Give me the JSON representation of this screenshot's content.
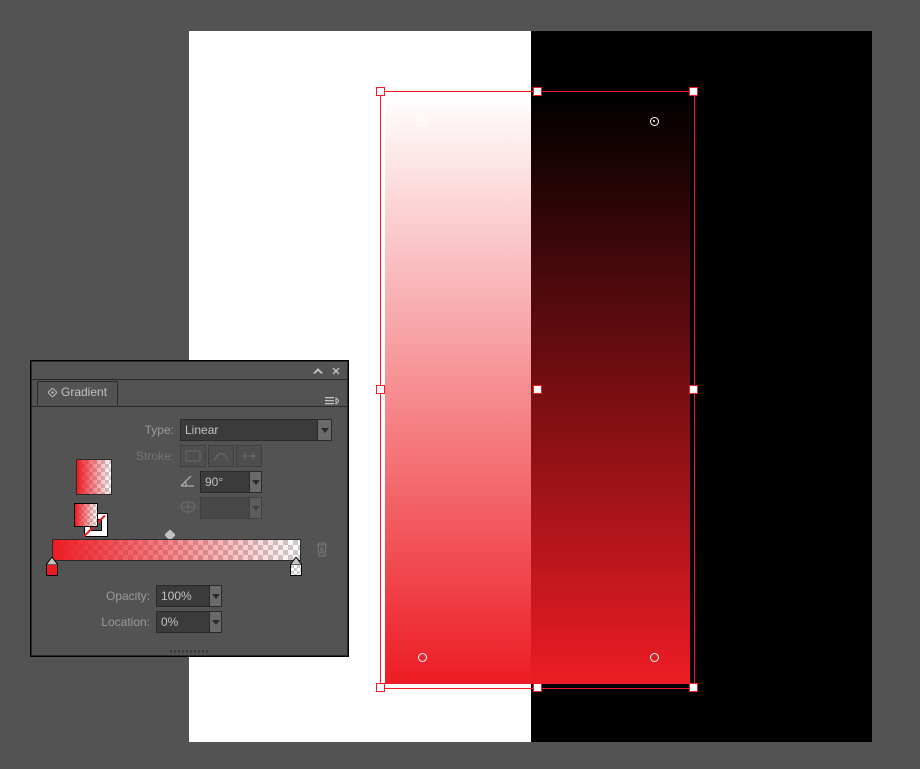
{
  "panel": {
    "title": "Gradient",
    "type_label": "Type:",
    "type_value": "Linear",
    "stroke_label": "Stroke:",
    "angle_value": "90°",
    "aspect_value": "",
    "opacity_label": "Opacity:",
    "opacity_value": "100%",
    "location_label": "Location:",
    "location_value": "0%"
  },
  "gradient": {
    "stops": [
      {
        "color": "#ed1c24",
        "opacity": 100,
        "location": 0
      },
      {
        "color": "#ed1c24",
        "opacity": 0,
        "location": 100
      }
    ],
    "midpoint": 50,
    "angle": 90
  },
  "artboard": {
    "left_bg": "#ffffff",
    "right_bg": "#000000"
  }
}
